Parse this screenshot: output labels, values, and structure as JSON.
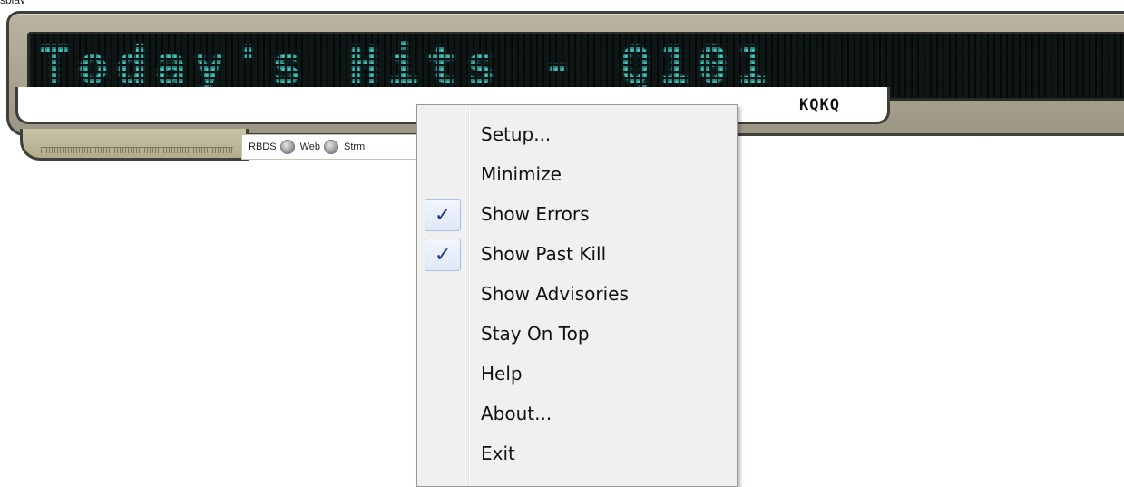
{
  "window": {
    "top_clip_text": "splay"
  },
  "display": {
    "led_text": "Today's Hits - Q101",
    "station": "KQKQ"
  },
  "indicators": [
    {
      "label": "RBDS"
    },
    {
      "label": "Web"
    },
    {
      "label": "Strm"
    }
  ],
  "context_menu": {
    "items": [
      {
        "label": "Setup...",
        "checked": false
      },
      {
        "label": "Minimize",
        "checked": false
      },
      {
        "label": "Show Errors",
        "checked": true
      },
      {
        "label": "Show Past Kill",
        "checked": true
      },
      {
        "label": "Show Advisories",
        "checked": false
      },
      {
        "label": "Stay On Top",
        "checked": false
      },
      {
        "label": "Help",
        "checked": false
      },
      {
        "label": "About...",
        "checked": false
      },
      {
        "label": "Exit",
        "checked": false
      }
    ],
    "check_glyph": "✓"
  },
  "colors": {
    "led": "#3cc6c0",
    "frame": "#b0ab95",
    "menu_bg": "#f0f0f0"
  }
}
